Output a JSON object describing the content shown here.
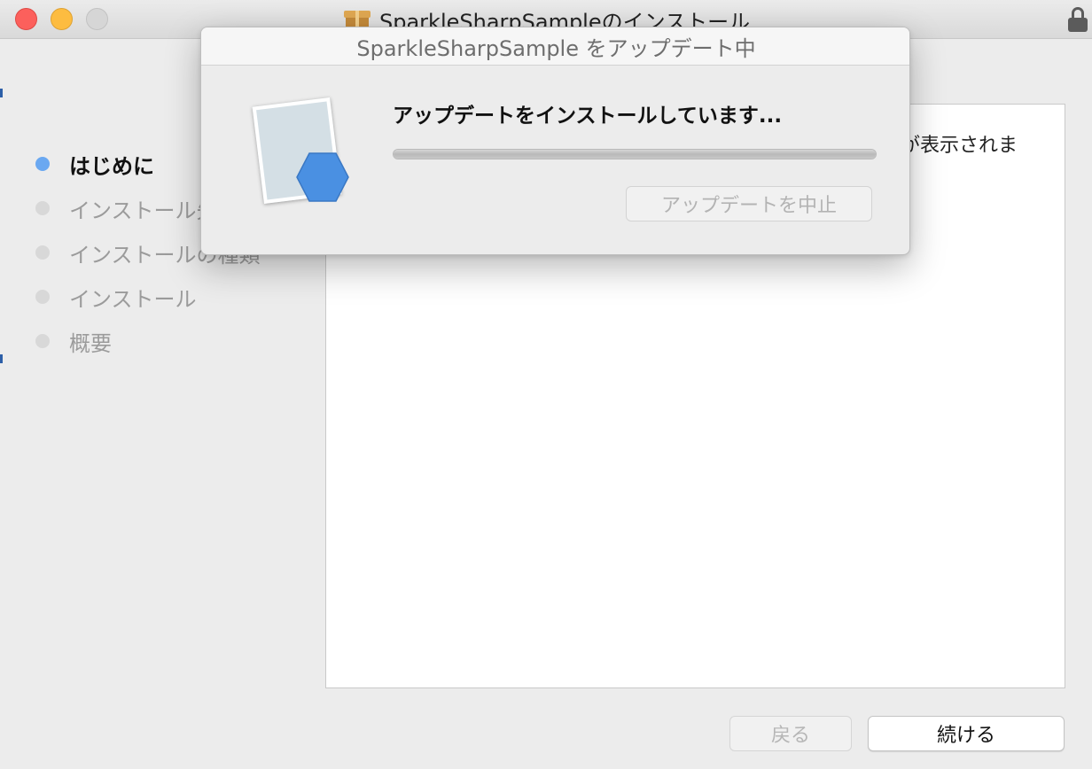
{
  "window": {
    "title": "SparkleSharpSampleのインストール",
    "icons": {
      "app": "package-icon",
      "lock": "lock-icon"
    }
  },
  "sidebar": {
    "steps": [
      {
        "label": "はじめに",
        "active": true
      },
      {
        "label": "インストール先",
        "active": false
      },
      {
        "label": "インストールの種類",
        "active": false
      },
      {
        "label": "インストール",
        "active": false
      },
      {
        "label": "概要",
        "active": false
      }
    ]
  },
  "content": {
    "text": "が表示されま"
  },
  "footer": {
    "back_label": "戻る",
    "continue_label": "続ける"
  },
  "dialog": {
    "title": "SparkleSharpSample をアップデート中",
    "heading": "アップデートをインストールしています...",
    "progress": 1.0,
    "cancel_label": "アップデートを中止",
    "icon": "app-document-icon"
  },
  "colors": {
    "accent": "#6aa8f1",
    "close": "#fc605c",
    "minimize": "#fdbc40",
    "zoom": "#d6d6d6",
    "hex": "#4a90e2"
  }
}
